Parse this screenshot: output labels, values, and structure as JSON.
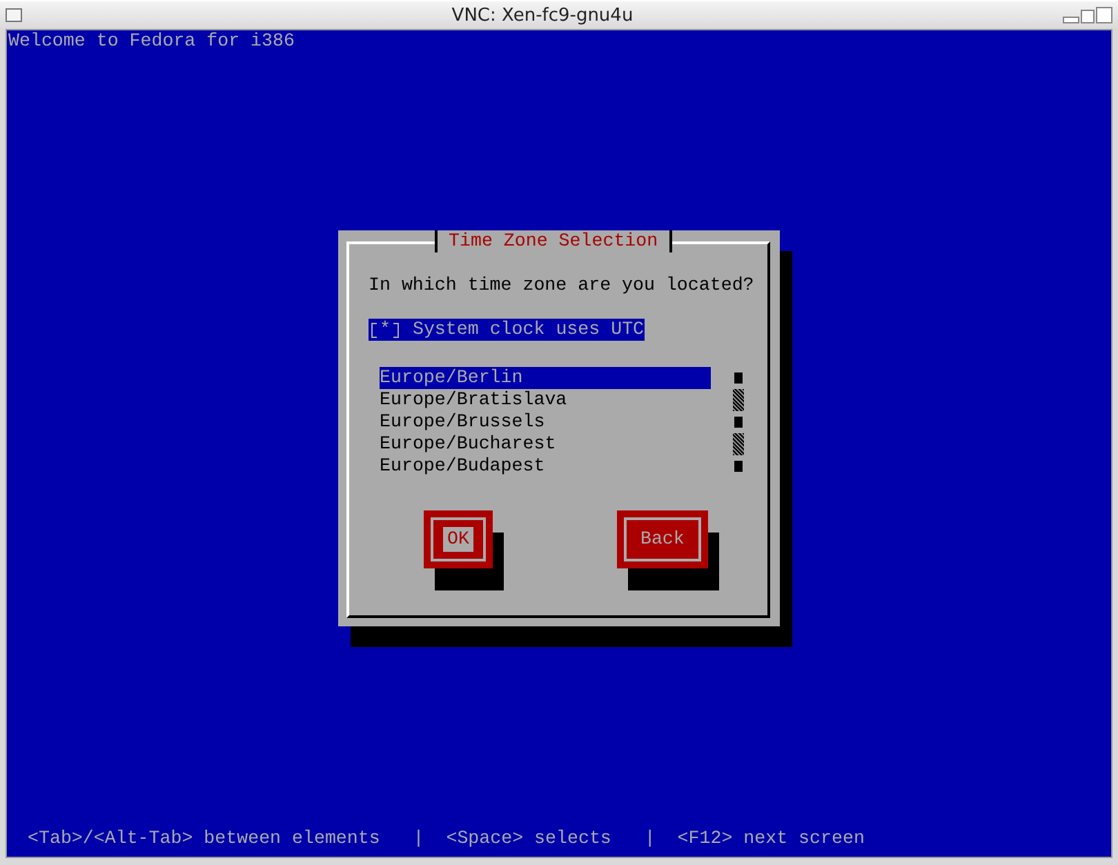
{
  "window": {
    "title": "VNC: Xen-fc9-gnu4u"
  },
  "header": "Welcome to Fedora for i386",
  "dialog": {
    "title": "Time Zone Selection",
    "question": "In which time zone are you located?",
    "checkbox": {
      "mark": "*",
      "label": "System clock uses UTC",
      "checked": true,
      "focused": true
    },
    "zones": [
      {
        "name": "Europe/Berlin",
        "selected": true
      },
      {
        "name": "Europe/Bratislava",
        "selected": false
      },
      {
        "name": "Europe/Brussels",
        "selected": false
      },
      {
        "name": "Europe/Bucharest",
        "selected": false
      },
      {
        "name": "Europe/Budapest",
        "selected": false
      }
    ],
    "buttons": [
      {
        "label": "OK",
        "focused": true
      },
      {
        "label": "Back",
        "focused": false
      }
    ]
  },
  "status_bar": "<Tab>/<Alt-Tab> between elements   |  <Space> selects   |  <F12> next screen"
}
